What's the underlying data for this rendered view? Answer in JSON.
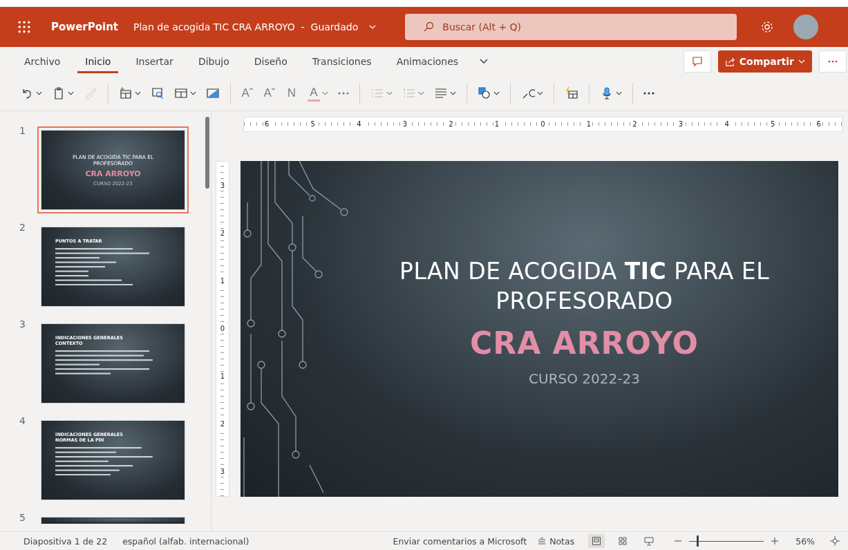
{
  "header": {
    "app_name": "PowerPoint",
    "document_title": "Plan de acogida TIC CRA ARROYO  -  Guardado",
    "search": {
      "placeholder": "Buscar (Alt + Q)"
    }
  },
  "tabs": [
    {
      "label": "Archivo",
      "selected": false
    },
    {
      "label": "Inicio",
      "selected": true
    },
    {
      "label": "Insertar",
      "selected": false
    },
    {
      "label": "Dibujo",
      "selected": false
    },
    {
      "label": "Diseño",
      "selected": false
    },
    {
      "label": "Transiciones",
      "selected": false
    },
    {
      "label": "Animaciones",
      "selected": false
    }
  ],
  "share_button": {
    "label": "Compartir"
  },
  "toolbar": [
    {
      "kind": "undo",
      "dropdown": true,
      "disabled": false
    },
    {
      "kind": "paste",
      "dropdown": true,
      "disabled": false
    },
    {
      "kind": "painter",
      "dropdown": false,
      "disabled": true
    },
    {
      "kind": "separator"
    },
    {
      "kind": "new-slide",
      "dropdown": true,
      "disabled": false
    },
    {
      "kind": "reuse",
      "dropdown": false,
      "disabled": false
    },
    {
      "kind": "layout",
      "dropdown": true,
      "disabled": false
    },
    {
      "kind": "background",
      "dropdown": false,
      "disabled": false
    },
    {
      "kind": "separator"
    },
    {
      "kind": "glyph",
      "glyph": "Aˆ",
      "dropdown": false,
      "disabled": true
    },
    {
      "kind": "glyph",
      "glyph": "Aˇ",
      "dropdown": false,
      "disabled": true
    },
    {
      "kind": "glyph",
      "glyph": "N",
      "dropdown": false,
      "disabled": true
    },
    {
      "kind": "font-color",
      "glyph": "A",
      "dropdown": true,
      "disabled": true
    },
    {
      "kind": "more",
      "dropdown": false,
      "disabled": true
    },
    {
      "kind": "separator"
    },
    {
      "kind": "bullets",
      "dropdown": true,
      "disabled": true
    },
    {
      "kind": "numbering",
      "dropdown": true,
      "disabled": true
    },
    {
      "kind": "align",
      "dropdown": true,
      "disabled": false
    },
    {
      "kind": "separator"
    },
    {
      "kind": "shapes",
      "dropdown": true,
      "disabled": false
    },
    {
      "kind": "separator"
    },
    {
      "kind": "find",
      "dropdown": true,
      "disabled": false
    },
    {
      "kind": "separator"
    },
    {
      "kind": "designer",
      "dropdown": false,
      "disabled": false
    },
    {
      "kind": "separator"
    },
    {
      "kind": "dictate",
      "dropdown": true,
      "disabled": false
    },
    {
      "kind": "separator"
    },
    {
      "kind": "more",
      "dropdown": false,
      "disabled": false
    }
  ],
  "slides": [
    {
      "number": "1",
      "kind": "title",
      "selected": true,
      "title": "PLAN DE ACOGIDA TIC PARA EL PROFESORADO",
      "subtitle": "CRA ARROYO",
      "footer": "CURSO 2022-23"
    },
    {
      "number": "2",
      "kind": "content",
      "selected": false,
      "title": "PUNTOS A TRATAR"
    },
    {
      "number": "3",
      "kind": "content",
      "selected": false,
      "title": "INDICACIONES GENERALES",
      "subtitle": "CONTEXTO"
    },
    {
      "number": "4",
      "kind": "content",
      "selected": false,
      "title": "INDICACIONES GENERALES",
      "subtitle": "NORMAS DE LA PDI"
    },
    {
      "number": "5",
      "kind": "partial",
      "selected": false
    }
  ],
  "ruler": {
    "horizontal": [
      "6",
      "5",
      "4",
      "3",
      "2",
      "1",
      "0",
      "1",
      "2",
      "3",
      "4",
      "5",
      "6"
    ],
    "vertical": [
      "3",
      "2",
      "1",
      "0",
      "1",
      "2",
      "3"
    ]
  },
  "current_slide": {
    "title": "PLAN DE ACOGIDA **TIC** PARA EL PROFESORADO",
    "subtitle": "CRA ARROYO",
    "footer": "CURSO 2022-23"
  },
  "status_bar": {
    "slide_counter": "Diapositiva 1 de 22",
    "language": "español (alfab. internacional)",
    "feedback": "Enviar comentarios a Microsoft",
    "notes_button": "Notas",
    "views": [
      {
        "kind": "normal",
        "selected": true
      },
      {
        "kind": "sorter",
        "selected": false
      },
      {
        "kind": "reading",
        "selected": false
      }
    ],
    "zoom": {
      "level": 0.1,
      "reading": "56%"
    }
  }
}
